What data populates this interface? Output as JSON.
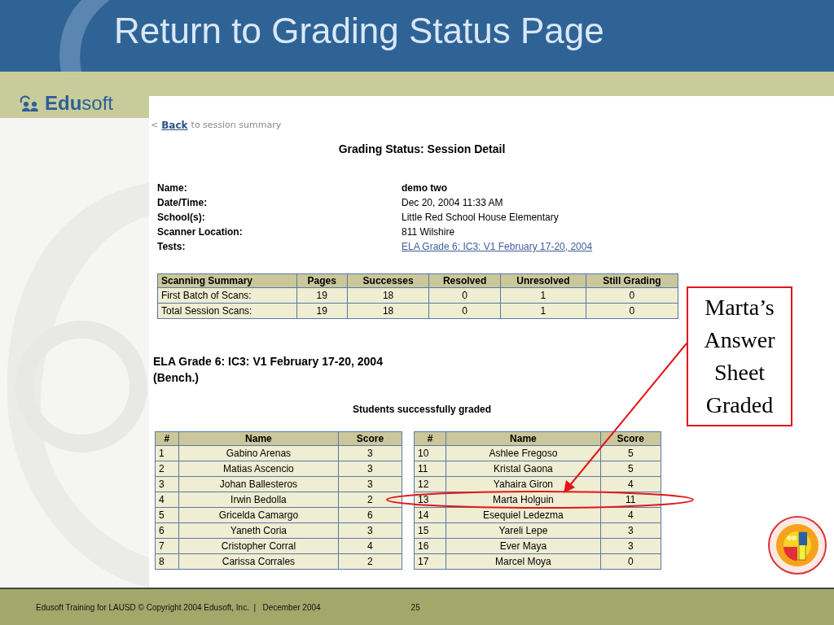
{
  "slide": {
    "title": "Return to Grading Status Page",
    "logo": "**Edu**soft"
  },
  "page": {
    "back_arrow": "<",
    "back_link": "Back",
    "back_text": "to session summary",
    "heading": "Grading Status: Session Detail",
    "details": [
      {
        "label": "Name:",
        "value": "demo two",
        "kind": "bold"
      },
      {
        "label": "Date/Time:",
        "value": "Dec 20, 2004 11:33 AM",
        "kind": "text"
      },
      {
        "label": "School(s):",
        "value": "Little Red School House Elementary",
        "kind": "text"
      },
      {
        "label": "Scanner Location:",
        "value": "811 Wilshire",
        "kind": "text"
      },
      {
        "label": "Tests:",
        "value": "ELA Grade 6: IC3: V1 February 17-20, 2004",
        "kind": "link"
      }
    ],
    "summary_table": {
      "columns": [
        "Scanning Summary",
        "Pages",
        "Successes",
        "Resolved",
        "Unresolved",
        "Still Grading"
      ],
      "rows": [
        [
          "First Batch of Scans:",
          "19",
          "18",
          "0",
          "1",
          "0"
        ],
        [
          "Total Session Scans:",
          "19",
          "18",
          "0",
          "1",
          "0"
        ]
      ]
    },
    "test_title": "ELA Grade 6: IC3: V1 February 17-20, 2004 (Bench.)",
    "graded_caption": "Students successfully graded",
    "student_tables": [
      {
        "columns": [
          "#",
          "Name",
          "Score"
        ],
        "rows": [
          [
            "1",
            "Gabino Arenas",
            "3"
          ],
          [
            "2",
            "Matias Ascencio",
            "3"
          ],
          [
            "3",
            "Johan Ballesteros",
            "3"
          ],
          [
            "4",
            "Irwin Bedolla",
            "2"
          ],
          [
            "5",
            "Gricelda Camargo",
            "6"
          ],
          [
            "6",
            "Yaneth Coria",
            "3"
          ],
          [
            "7",
            "Cristopher Corral",
            "4"
          ],
          [
            "8",
            "Carissa Corrales",
            "2"
          ]
        ]
      },
      {
        "columns": [
          "#",
          "Name",
          "Score"
        ],
        "rows": [
          [
            "10",
            "Ashlee Fregoso",
            "5"
          ],
          [
            "11",
            "Kristal Gaona",
            "5"
          ],
          [
            "12",
            "Yahaira Giron",
            "4"
          ],
          [
            "13",
            "Marta Holguin",
            "11"
          ],
          [
            "14",
            "Esequiel Ledezma",
            "4"
          ],
          [
            "15",
            "Yareli Lepe",
            "3"
          ],
          [
            "16",
            "Ever Maya",
            "3"
          ],
          [
            "17",
            "Marcel Moya",
            "0"
          ]
        ]
      }
    ]
  },
  "callout": "Marta’s Answer Sheet Graded",
  "footer": {
    "text": "Edusoft Training for LAUSD © Copyright 2004 Edusoft, Inc.  |   December 2004",
    "page_number": "25"
  }
}
